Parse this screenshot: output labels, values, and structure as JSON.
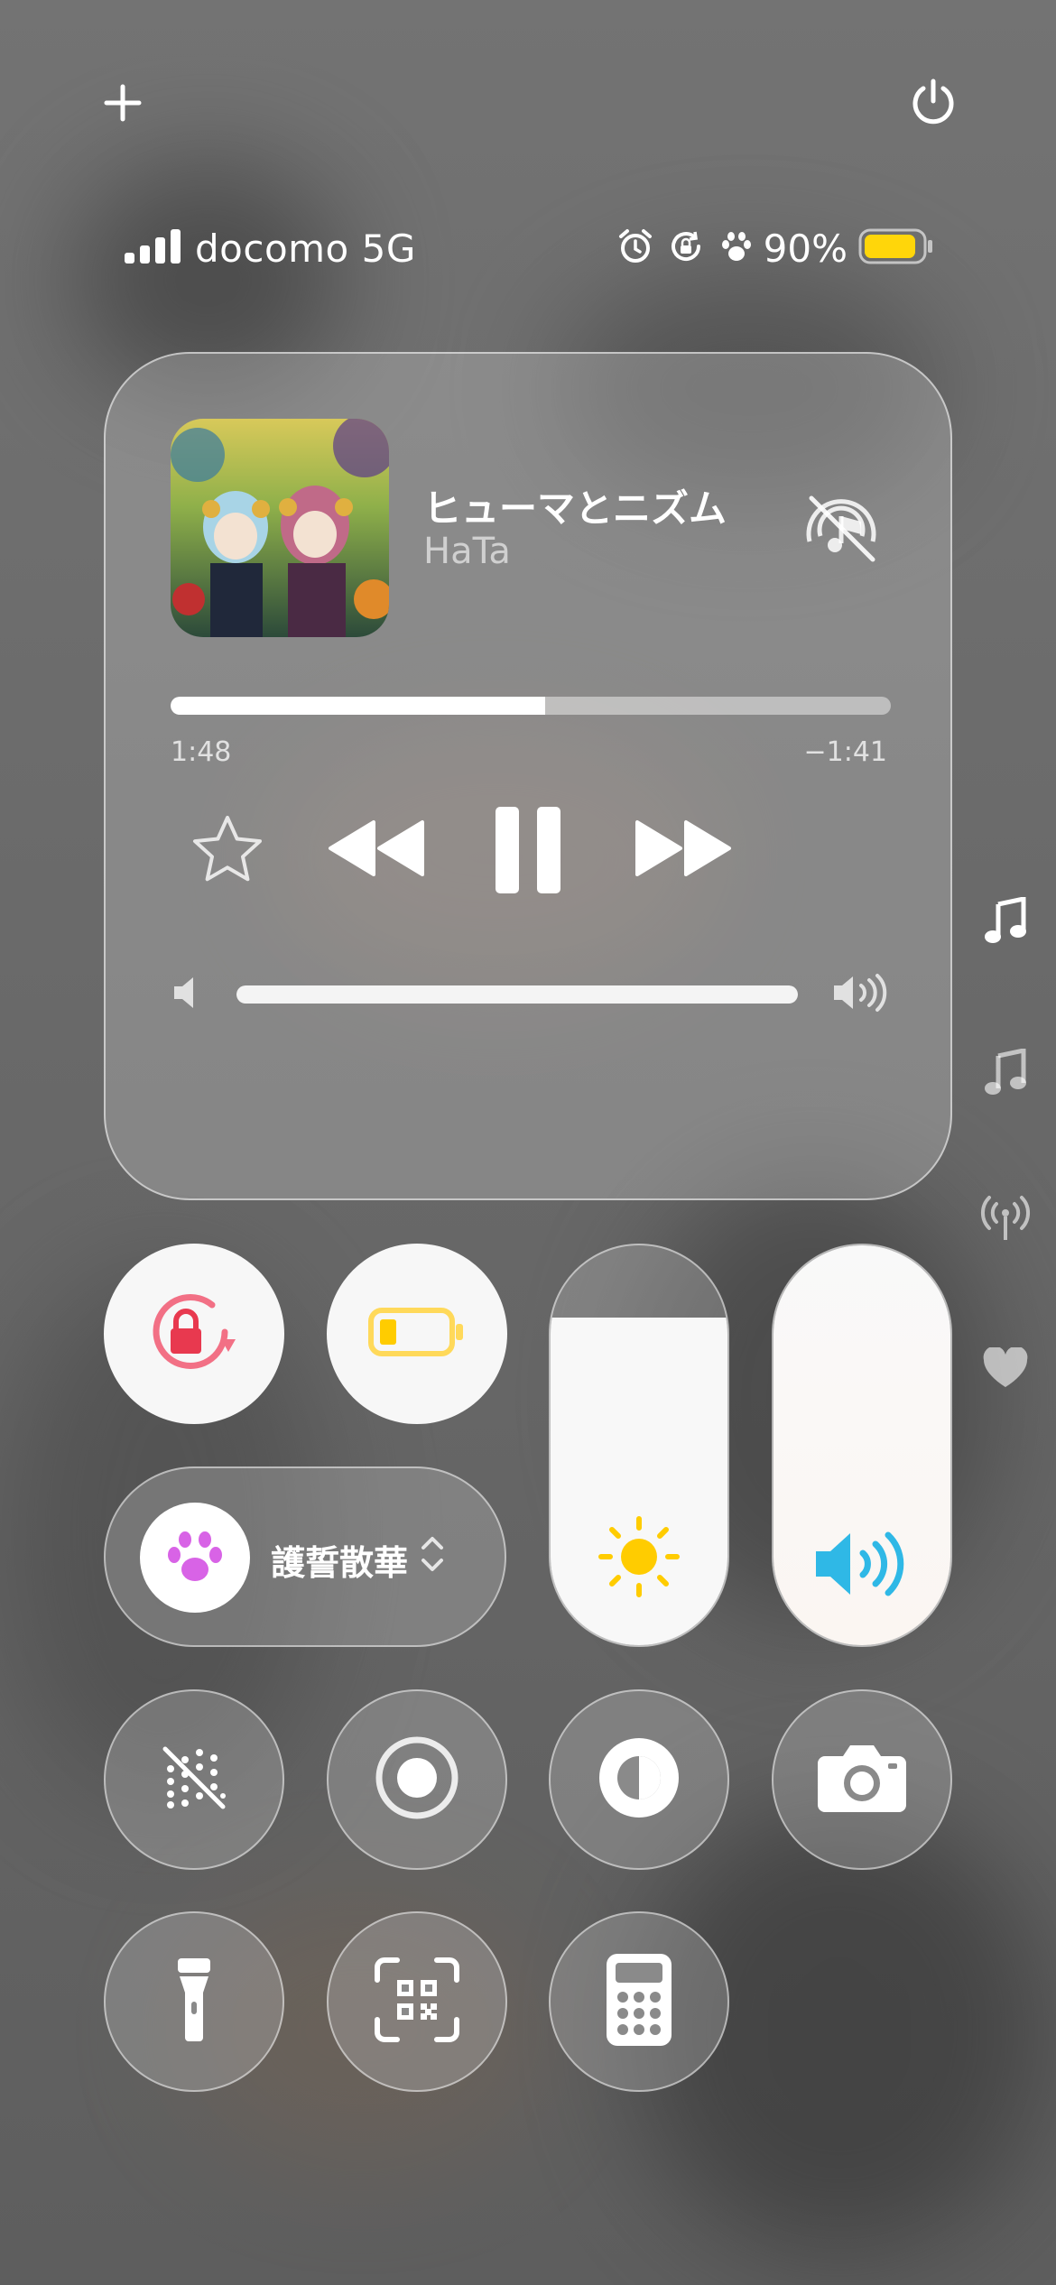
{
  "header": {
    "add_icon": "plus-icon",
    "power_icon": "power-icon"
  },
  "status_bar": {
    "carrier": "docomo 5G",
    "battery_percent": "90%",
    "battery_level": 0.9,
    "battery_color": "#FFD60A",
    "icons": [
      "cellular-signal-icon",
      "alarm-icon",
      "orientation-lock-icon",
      "paw-icon",
      "battery-icon"
    ]
  },
  "now_playing": {
    "title": "ヒューマとニズム",
    "artist": "HaTa",
    "elapsed": "1:48",
    "remaining": "−1:41",
    "progress": 0.52,
    "volume": 1.0,
    "audio_output_icon": "airplay-off-icon"
  },
  "controls": {
    "orientation_lock": {
      "icon": "orientation-lock-icon",
      "color": "#F05A6E"
    },
    "low_power": {
      "icon": "low-power-battery-icon",
      "color": "#FFD60A"
    },
    "focus": {
      "label": "護誓散華",
      "icon": "paw-icon",
      "color": "#D863E6"
    },
    "brightness": {
      "icon": "sun-icon",
      "level": 0.82,
      "color": "#FFCC00"
    },
    "volume": {
      "icon": "speaker-icon",
      "level": 1.0,
      "color": "#2FB8E6"
    },
    "tiles": [
      "dots-off-icon",
      "screen-record-icon",
      "dark-mode-icon",
      "camera-icon",
      "flashlight-icon",
      "qr-scan-icon",
      "calculator-icon"
    ]
  },
  "sidebar_icons": [
    "music-note-icon",
    "music-note-outline-icon",
    "wireless-broadcast-icon",
    "heart-icon"
  ]
}
